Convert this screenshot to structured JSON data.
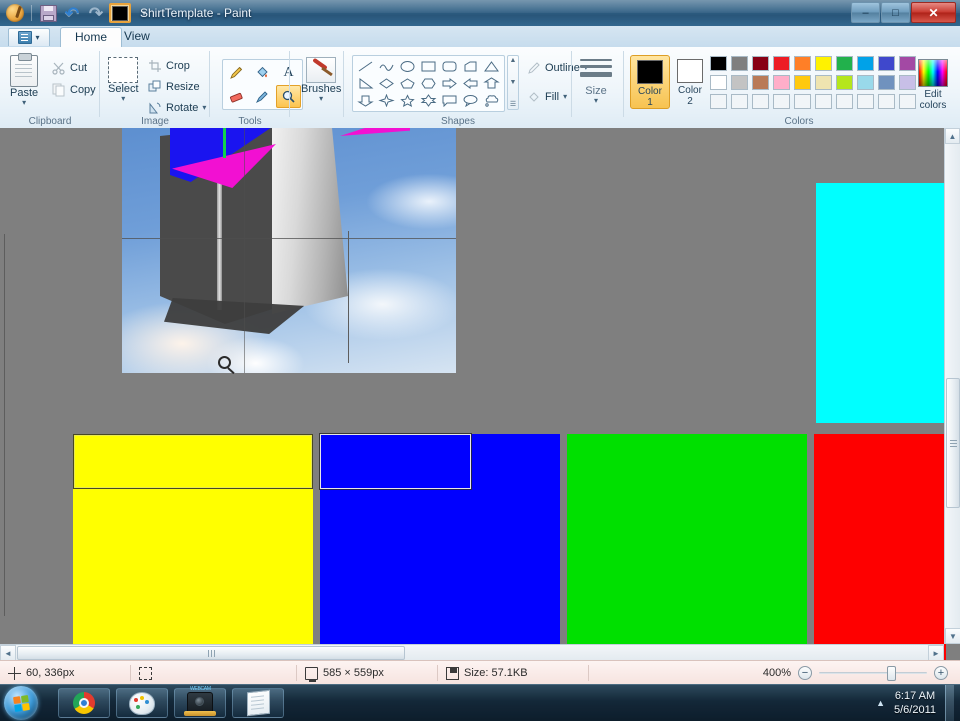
{
  "window": {
    "title": "ShirtTemplate - Paint",
    "app_logo_icon": "paint-palette-icon",
    "quick_access": [
      {
        "name": "save-icon",
        "label": "Save"
      },
      {
        "name": "undo-icon",
        "label": "Undo",
        "glyph": "↶"
      },
      {
        "name": "redo-icon",
        "label": "Redo",
        "glyph": "↷"
      },
      {
        "name": "color-picker-icon",
        "label": "Color"
      },
      {
        "name": "customize-qat-icon",
        "label": "Customize Quick Access Toolbar",
        "glyph": "▾"
      }
    ],
    "controls": {
      "minimize": "–",
      "maximize": "□",
      "close": "✕"
    }
  },
  "tabs": {
    "app_menu_label": "▾",
    "items": [
      {
        "label": "Home",
        "active": true
      },
      {
        "label": "View",
        "active": false
      }
    ]
  },
  "ribbon": {
    "groups": [
      {
        "name": "clipboard",
        "label": "Clipboard",
        "big_button": {
          "label": "Paste",
          "has_menu": true
        },
        "small_buttons": [
          {
            "label": "Cut",
            "icon": "scissors-icon",
            "enabled": false
          },
          {
            "label": "Copy",
            "icon": "copy-icon",
            "enabled": false
          }
        ]
      },
      {
        "name": "image",
        "label": "Image",
        "big_button": {
          "label": "Select",
          "has_menu": true
        },
        "small_buttons": [
          {
            "label": "Crop",
            "icon": "crop-icon",
            "enabled": false
          },
          {
            "label": "Resize",
            "icon": "resize-icon",
            "enabled": true
          },
          {
            "label": "Rotate",
            "icon": "rotate-icon",
            "enabled": true,
            "has_menu": true
          }
        ]
      },
      {
        "name": "tools",
        "label": "Tools",
        "tools": [
          {
            "name": "pencil-tool",
            "glyph": "✎",
            "selected": false
          },
          {
            "name": "fill-tool",
            "glyph": "◢",
            "selected": false
          },
          {
            "name": "text-tool",
            "glyph": "A",
            "selected": false
          },
          {
            "name": "eraser-tool",
            "glyph": "▬",
            "selected": false
          },
          {
            "name": "color-picker-tool",
            "glyph": "✒",
            "selected": false
          },
          {
            "name": "magnifier-tool",
            "glyph": "⚲",
            "selected": true
          }
        ]
      },
      {
        "name": "brushes",
        "label": "Brushes",
        "big_button": {
          "label": "Brushes",
          "has_menu": true
        }
      },
      {
        "name": "shapes",
        "label": "Shapes",
        "outline_label": "Outline",
        "fill_label": "Fill",
        "outline_enabled": false,
        "fill_enabled": false,
        "shape_names": [
          "line-shape",
          "curve-shape",
          "oval-shape",
          "rectangle-shape",
          "rounded-rectangle-shape",
          "polygon-shape",
          "triangle-shape",
          "right-triangle-shape",
          "diamond-shape",
          "pentagon-shape",
          "hexagon-shape",
          "right-arrow-shape",
          "left-arrow-shape",
          "up-arrow-shape",
          "down-arrow-shape",
          "four-point-star-shape",
          "five-point-star-shape",
          "six-point-star-shape",
          "rounded-callout-shape",
          "oval-callout-shape",
          "cloud-callout-shape"
        ]
      },
      {
        "name": "size",
        "label": "Size",
        "big_button": {
          "label": "Size",
          "has_menu": true
        }
      },
      {
        "name": "colors",
        "label": "Colors",
        "color1": {
          "label_line1": "Color",
          "label_line2": "1",
          "value": "#000000",
          "active": true
        },
        "color2": {
          "label_line1": "Color",
          "label_line2": "2",
          "value": "#ffffff",
          "active": false
        },
        "edit_colors": {
          "label_line1": "Edit",
          "label_line2": "colors"
        },
        "palette_row1": [
          "#000000",
          "#7f7f7f",
          "#880015",
          "#ed1c24",
          "#ff7f27",
          "#fff200",
          "#22b14c",
          "#00a2e8",
          "#3f48cc",
          "#a349a4"
        ],
        "palette_row2": [
          "#ffffff",
          "#c3c3c3",
          "#b97a57",
          "#ffaec9",
          "#ffc90e",
          "#efe4b0",
          "#b5e61d",
          "#99d9ea",
          "#7092be",
          "#c8bfe7"
        ],
        "palette_row3": [
          "",
          "",
          "",
          "",
          "",
          "",
          "",
          "",
          "",
          ""
        ]
      }
    ]
  },
  "canvas": {
    "background_color": "#7f7f7f",
    "image_description": "shirt-template-3d-preview",
    "cursor_icon": "magnifier-cursor",
    "shapes": [
      {
        "name": "cyan-rectangle",
        "color": "#00ffff"
      },
      {
        "name": "yellow-rectangle",
        "color": "#ffff00"
      },
      {
        "name": "blue-rectangle",
        "color": "#0000ff"
      },
      {
        "name": "green-rectangle",
        "color": "#00e000"
      },
      {
        "name": "red-rectangle",
        "color": "#fe0000"
      }
    ],
    "scrollbars": {
      "vertical_up": "▲",
      "vertical_down": "▼",
      "horizontal_left": "◄",
      "horizontal_right": "►"
    }
  },
  "status_bar": {
    "cursor_position": "60, 336px",
    "cursor_icon": "crosshair-icon",
    "selection_size": "",
    "selection_icon": "selection-size-icon",
    "image_size": "585 × 559px",
    "image_size_icon": "canvas-size-icon",
    "file_size": "Size: 57.1KB",
    "file_size_icon": "save-disk-icon",
    "zoom_level": "400%",
    "zoom_out_glyph": "−",
    "zoom_in_glyph": "+"
  },
  "taskbar": {
    "start_label": "Start",
    "buttons": [
      {
        "name": "taskbar-chrome",
        "icon": "chrome-icon"
      },
      {
        "name": "taskbar-paint",
        "icon": "paint-palette-icon"
      },
      {
        "name": "taskbar-webcam",
        "icon": "webcam-icon",
        "text": "WEBCAM"
      },
      {
        "name": "taskbar-notepad",
        "icon": "notepad-icon"
      }
    ],
    "tray": {
      "show_hidden_glyph": "▲",
      "time": "6:17 AM",
      "date": "5/6/2011"
    }
  }
}
